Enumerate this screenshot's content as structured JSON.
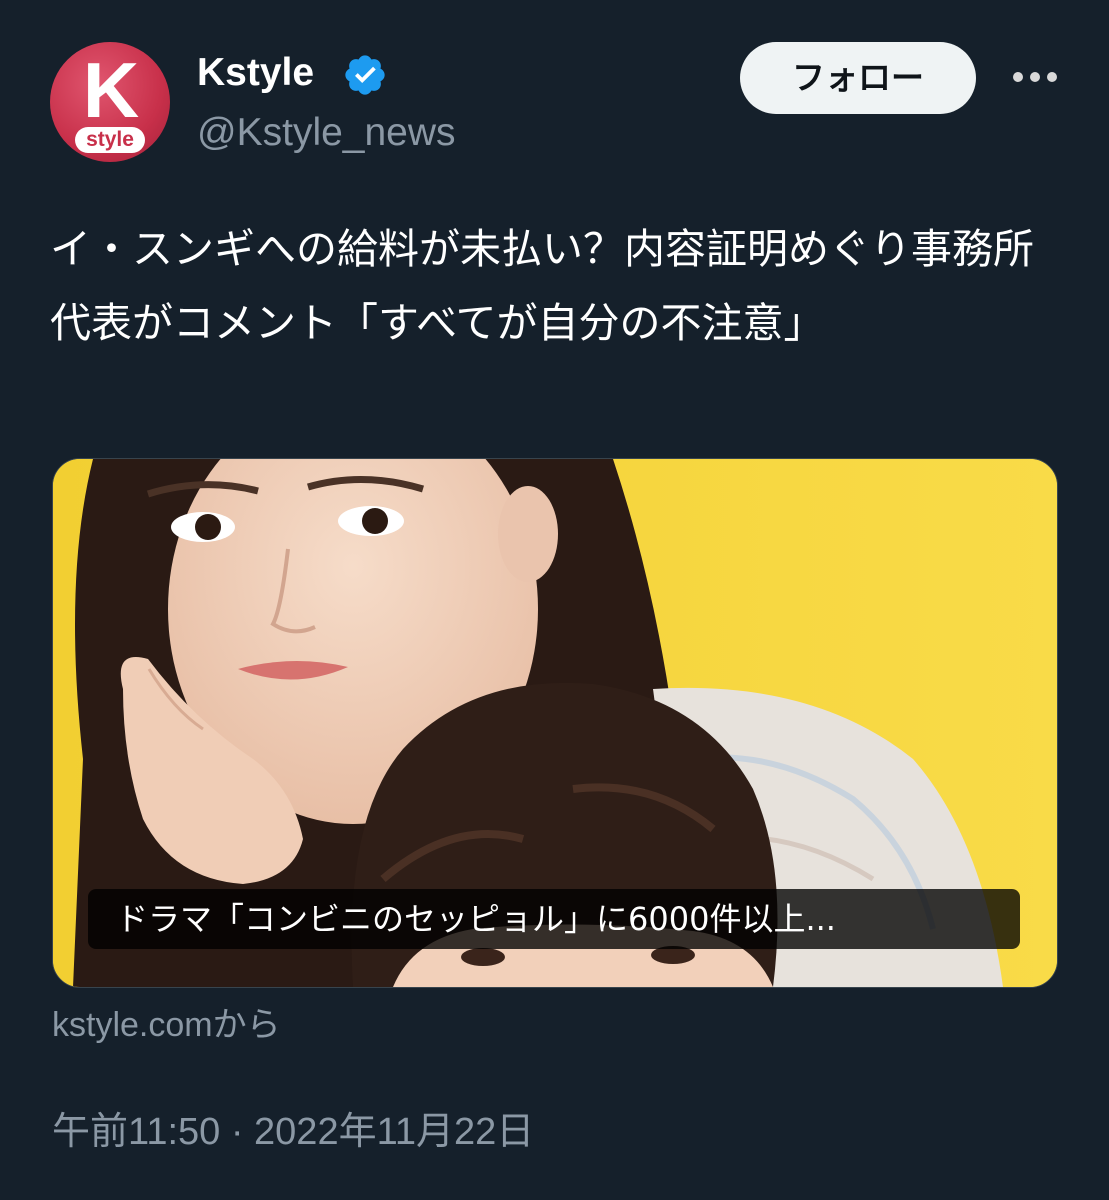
{
  "tweet": {
    "author": {
      "display_name": "Kstyle",
      "handle": "@Kstyle_news",
      "verified": true,
      "avatar": {
        "letter": "K",
        "sublabel": "style",
        "color": "#c8304a"
      }
    },
    "follow_label": "フォロー",
    "more_icon": "more-horizontal-icon",
    "text": "イ・スンギへの給料が未払い？内容証明めぐり事務所代表がコメント「すべてが自分の不注意」",
    "card": {
      "caption": "ドラマ「コンビニのセッピョル」に6000件以上...",
      "background_color": "#f7d63b"
    },
    "source": "kstyle.comから",
    "timestamp": "午前11:50 · 2022年11月22日"
  },
  "colors": {
    "background": "#15202b",
    "text_primary": "#ffffff",
    "text_secondary": "#8b98a5",
    "verified_badge": "#1d9bf0",
    "follow_button_bg": "#eff3f4"
  }
}
